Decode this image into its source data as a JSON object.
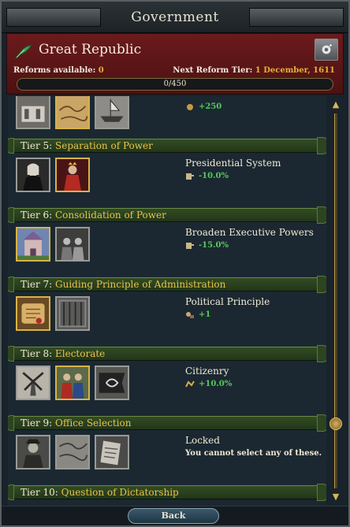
{
  "window": {
    "title": "Government"
  },
  "header": {
    "government_type": "Great Republic",
    "reforms_label": "Reforms available:",
    "reforms_value": "0",
    "next_label": "Next Reform Tier:",
    "next_value": "1 December, 1611",
    "progress_text": "0/450",
    "progress_fraction": 0.0,
    "icons": {
      "government": "quill-icon",
      "settings": "reform-settings-icon"
    }
  },
  "partial_row": {
    "effect": "+250",
    "icons": [
      "building-icon",
      "map-icon",
      "ship-icon"
    ]
  },
  "tiers": [
    {
      "num": "Tier 5:",
      "name": "Separation of Power",
      "title": "Presidential System",
      "effect": "-10.0%",
      "desc": "",
      "icons": [
        "judge-portrait-icon",
        "king-portrait-icon"
      ]
    },
    {
      "num": "Tier 6:",
      "name": "Consolidation of Power",
      "title": "Broaden Executive Powers",
      "effect": "-15.0%",
      "desc": "",
      "icons": [
        "palace-icon",
        "council-icon"
      ]
    },
    {
      "num": "Tier 7:",
      "name": "Guiding Principle of Administration",
      "title": "Political Principle",
      "effect": "+1",
      "desc": "",
      "icons": [
        "scroll-icon",
        "prison-icon"
      ]
    },
    {
      "num": "Tier 8:",
      "name": "Electorate",
      "title": "Citizenry",
      "effect": "+10.0%",
      "desc": "",
      "icons": [
        "windmill-icon",
        "merchants-icon",
        "banner-icon"
      ]
    },
    {
      "num": "Tier 9:",
      "name": "Office Selection",
      "title": "Locked",
      "effect": "",
      "desc": "You cannot select any of these.",
      "icons": [
        "nobleman-icon",
        "map-icon",
        "document-icon"
      ]
    },
    {
      "num": "Tier 10:",
      "name": "Question of Dictatorship",
      "title": "",
      "effect": "",
      "desc": "",
      "icons": []
    }
  ],
  "footer": {
    "back_label": "Back"
  }
}
